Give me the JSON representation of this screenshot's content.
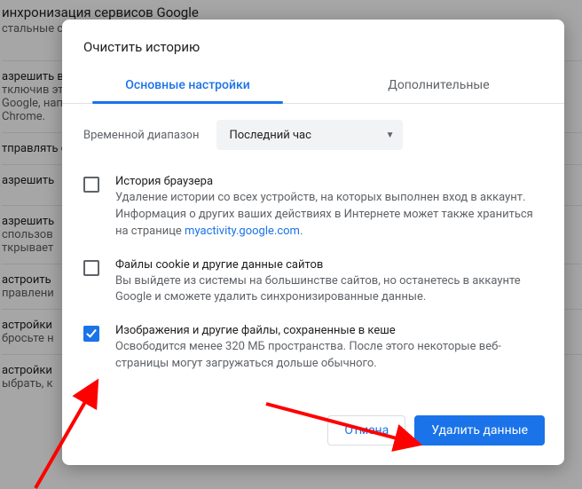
{
  "background": {
    "heading": "инхронизация сервисов Google",
    "subheading": "стальные сервисы Google",
    "rows": [
      {
        "title": "азрешить вход в Chrome",
        "sub": "тключив эту функцию, вы сможете входить в аккаунты на сайтах Google, например Gmail, без еобходимости выполнять вход в Chrome."
      },
      {
        "title": "тправлять страницу «Расширенная защита»",
        "sub": ""
      },
      {
        "title": "азрешить",
        "sub": ""
      },
      {
        "title": "азрешить",
        "sub": "спользов\nткрывает"
      },
      {
        "title": "астроить",
        "sub": "правлени"
      },
      {
        "title": "астройки",
        "sub": "бросьте н"
      },
      {
        "title": "астройки",
        "sub": "ыбрать, к"
      }
    ]
  },
  "dialog": {
    "title": "Очистить историю",
    "tabs": {
      "basic": "Основные настройки",
      "advanced": "Дополнительные"
    },
    "range_label": "Временной диапазон",
    "range_value": "Последний час",
    "options": [
      {
        "checked": false,
        "title": "История браузера",
        "desc_pre": "Удаление истории со всех устройств, на которых выполнен вход в аккаунт. Информация о других ваших действиях в Интернете может также храниться на странице ",
        "link": "myactivity.google.com",
        "desc_post": "."
      },
      {
        "checked": false,
        "title": "Файлы cookie и другие данные сайтов",
        "desc_pre": "Вы выйдете из системы на большинстве сайтов, но останетесь в аккаунте Google и сможете удалить синхронизированные данные.",
        "link": "",
        "desc_post": ""
      },
      {
        "checked": true,
        "title": "Изображения и другие файлы, сохраненные в кеше",
        "desc_pre": "Освободится менее 320 МБ пространства. После этого некоторые веб-страницы могут загружаться дольше обычного.",
        "link": "",
        "desc_post": ""
      }
    ],
    "buttons": {
      "cancel": "Отмена",
      "confirm": "Удалить данные"
    }
  }
}
